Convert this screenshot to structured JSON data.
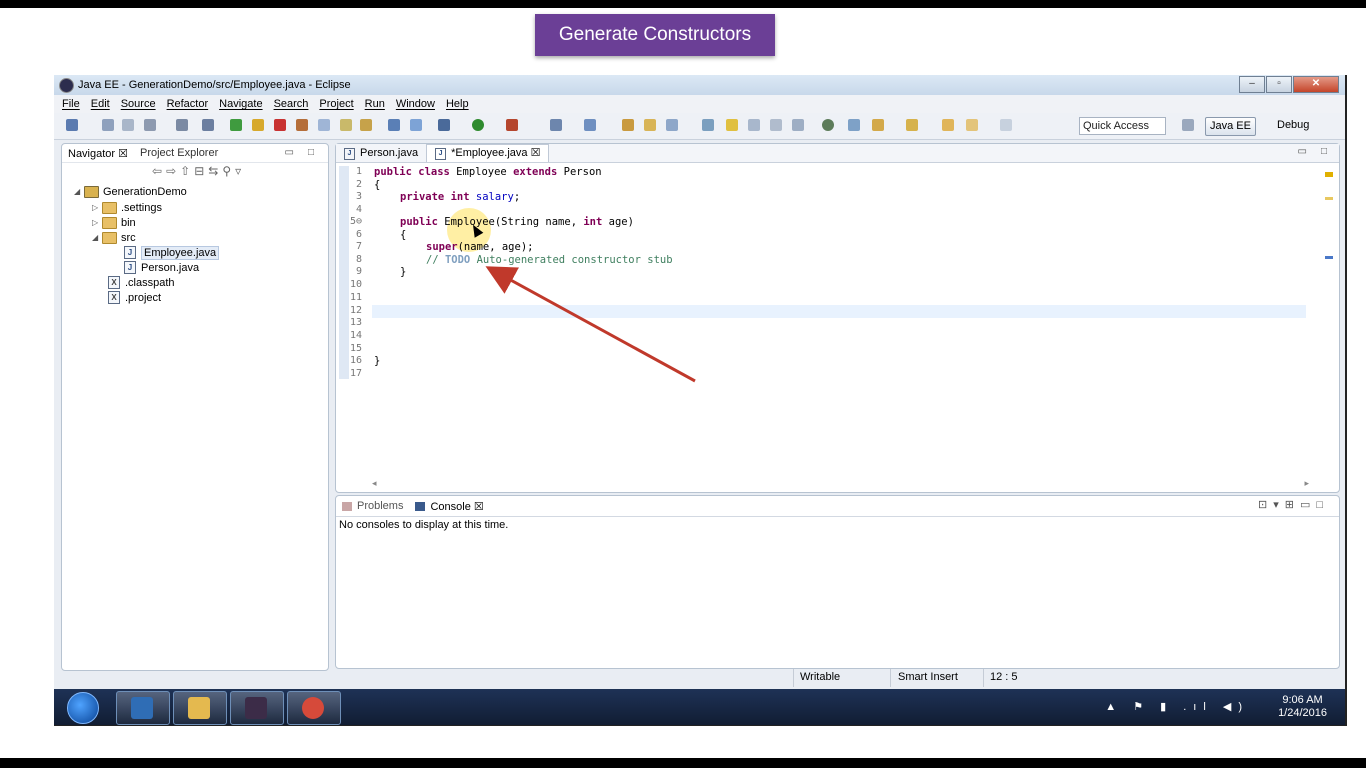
{
  "caption": "Generate Constructors",
  "window": {
    "title": "Java EE - GenerationDemo/src/Employee.java - Eclipse",
    "controls": {
      "minimize": "–",
      "maximize": "▫",
      "close": "✕"
    }
  },
  "menu": [
    "File",
    "Edit",
    "Source",
    "Refactor",
    "Navigate",
    "Search",
    "Project",
    "Run",
    "Window",
    "Help"
  ],
  "toolbar": {
    "quick_access": "Quick Access",
    "perspective_javaee": "Java EE",
    "perspective_debug": "Debug"
  },
  "navigator": {
    "tab_navigator": "Navigator ☒",
    "tab_explorer": "Project Explorer",
    "tree": {
      "project": "GenerationDemo",
      "settings": ".settings",
      "bin": "bin",
      "src": "src",
      "employee": "Employee.java",
      "person": "Person.java",
      "classpath": ".classpath",
      "project_file": ".project"
    }
  },
  "editor": {
    "tab_person": "Person.java",
    "tab_employee": "*Employee.java ☒",
    "line_numbers": [
      "1",
      "2",
      "3",
      "4",
      "5⊖",
      "6",
      "7",
      "8",
      "9",
      "10",
      "11",
      "12",
      "13",
      "14",
      "15",
      "16",
      "17"
    ],
    "code": {
      "l1_kw1": "public class",
      "l1_name": " Employee ",
      "l1_kw2": "extends",
      "l1_super": " Person",
      "l2": "{",
      "l3_kw": "private int",
      "l3_field": "salary",
      "l3_end": ";",
      "l5_kw": "public",
      "l5_name": " Employee(String name, ",
      "l5_kw2": "int",
      "l5_end": " age)",
      "l6": "{",
      "l7_kw": "super",
      "l7_end": "(name, age);",
      "l8_slash": "// ",
      "l8_todo": "TODO",
      "l8_text": " Auto-generated constructor stub",
      "l9": "}",
      "l16": "}"
    }
  },
  "console": {
    "tab_problems": "Problems",
    "tab_console": "Console ☒",
    "message": "No consoles to display at this time."
  },
  "status": {
    "writable": "Writable",
    "insert_mode": "Smart Insert",
    "position": "12 : 5"
  },
  "taskbar": {
    "time": "9:06 AM",
    "date": "1/24/2016",
    "tray_icons": "▲ ⚑ ▮ .ıl ◀)"
  },
  "colors": {
    "caption_bg": "#6b3f96",
    "keyword": "#7f0055",
    "field": "#0000c0",
    "comment": "#3f7f5f",
    "annotation_arrow": "#c0392b"
  }
}
